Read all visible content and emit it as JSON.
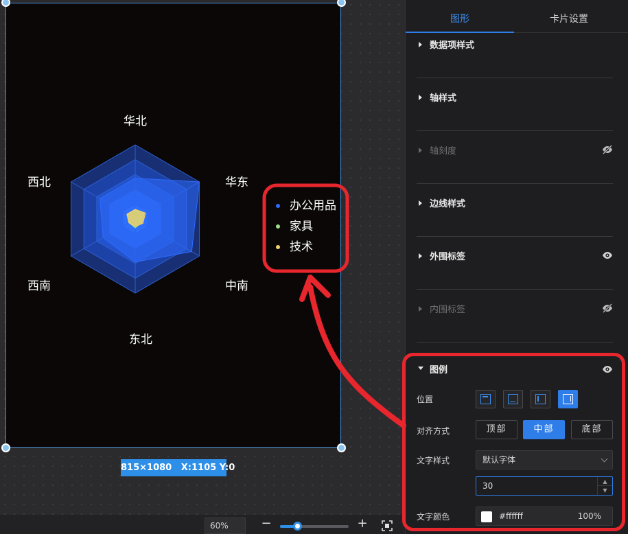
{
  "canvas": {
    "size_tag": "815×1080   X:1105 Y:0",
    "chart_data": {
      "type": "radar",
      "indicators": [
        "华北",
        "华东",
        "中南",
        "东北",
        "西南",
        "西北"
      ],
      "series": [
        {
          "name": "办公用品",
          "color": "#2e6bff",
          "values": [
            0.55,
            1.0,
            0.88,
            0.58,
            0.5,
            0.55
          ]
        },
        {
          "name": "家具",
          "color": "#9be08a",
          "values": [
            0.12,
            0.14,
            0.1,
            0.12,
            0.1,
            0.12
          ]
        },
        {
          "name": "技术",
          "color": "#f4d06a",
          "values": [
            0.13,
            0.16,
            0.12,
            0.1,
            0.1,
            0.13
          ]
        }
      ],
      "legend": {
        "position": "right",
        "align": "middle"
      }
    }
  },
  "toolbar": {
    "zoom": "60%",
    "zoom_out": "−",
    "zoom_in": "+",
    "zoom_fraction": 0.25
  },
  "panel": {
    "tabs": [
      {
        "label": "图形",
        "active": true
      },
      {
        "label": "卡片设置",
        "active": false
      }
    ],
    "sections": [
      {
        "title": "数据项样式",
        "enabled": true,
        "eye": ""
      },
      {
        "title": "轴样式",
        "enabled": true,
        "eye": ""
      },
      {
        "title": "轴刻度",
        "enabled": false,
        "eye": "eye-off-icon"
      },
      {
        "title": "边线样式",
        "enabled": true,
        "eye": ""
      },
      {
        "title": "外围标签",
        "enabled": true,
        "eye": "eye-icon"
      },
      {
        "title": "内围标签",
        "enabled": false,
        "eye": "eye-off-icon"
      }
    ],
    "legend": {
      "title": "图例",
      "position_label": "位置",
      "position_options": [
        "top",
        "bottom",
        "left",
        "right"
      ],
      "position_selected": "right",
      "align_label": "对齐方式",
      "align_options": [
        "顶部",
        "中部",
        "底部"
      ],
      "align_selected": "中部",
      "text_style_label": "文字样式",
      "font_family": "默认字体",
      "font_size": "30",
      "text_color_label": "文字颜色",
      "text_color": "#ffffff",
      "text_opacity": "100%"
    }
  },
  "colors": {
    "accent": "#2e7de8",
    "annotation": "#e8262e",
    "canvas_bg": "#0b0707"
  }
}
